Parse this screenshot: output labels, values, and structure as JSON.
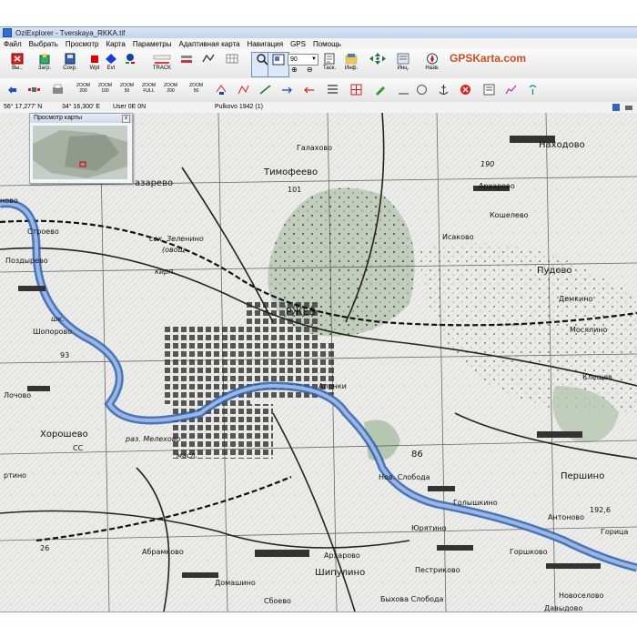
{
  "window": {
    "title": "OziExplorer - Tverskaya_RKKA.tif"
  },
  "menu": [
    "Файл",
    "Выбрать",
    "Просмотр",
    "Карта",
    "Параметры",
    "Адаптивная карта",
    "Навигация",
    "GPS",
    "Помощь"
  ],
  "toolbar": {
    "exit_label": "Вы..",
    "load_label": "Загр.",
    "save_label": "Сохр.",
    "wpt_label": "Wpt",
    "evt_label": "Evt",
    "track_label": "TRACK",
    "zoom_value": "90",
    "task_label": "Таск.",
    "info_label": "Инф.",
    "info2_label": "Инц.",
    "nav_label": "Назв.",
    "brand": "GPSKarta.com"
  },
  "toolbar2": {
    "zoom_buttons": [
      "ZOOM 200",
      "ZOOM 100",
      "ZOOM 50",
      "ZOOM FULL",
      "ZOOM 200",
      "ZOOM 50"
    ]
  },
  "status": {
    "lat": "56° 17,277' N",
    "lon": "34° 16,300' E",
    "user": "User 0E  0N",
    "datum": "Pulkovo 1942 (1)"
  },
  "overview": {
    "title": "Просмотр карты",
    "close": "x"
  },
  "map_labels": {
    "rzhev": "РЖЕВ",
    "timofeevo": "Тимофеево",
    "galahovo": "Галахово",
    "nahodovo": "Находово",
    "arharovo1": "Архарово",
    "koshelevo": "Кошелево",
    "isakovo": "Исаково",
    "pudovo": "Пудово",
    "demkino": "Демкино",
    "mosyalino": "Мосялино",
    "kleshevo": "Клещев",
    "lazarevo": "азарево",
    "lovo": "ново",
    "strojevo": "Строево",
    "pozdyrevo": "Поздырево",
    "zelenino": "сех. Зеленино",
    "ovosh": "(овощ",
    "kirp": "кирп.",
    "shoporovo": "Шопорово",
    "shk": "шк.",
    "aponki": "Апонки",
    "meleshovo": "раз. Мелехово",
    "masl": "масл.",
    "khoroshevo": "Хорошево",
    "otino": "ртино",
    "cc": "СС",
    "nov_sloboda": "Нов. Слобода",
    "golyshkino": "Голышкино",
    "pershino": "Першино",
    "antonovo": "Антоново",
    "goricy": "Горица",
    "yurtatino": "Юрятино",
    "goroshkovo": "Горшково",
    "arharovo2": "Архарово",
    "abramkovo": "Абрамково",
    "shipulino": "Шипулино",
    "pestrikovo": "Пестриково",
    "domashino": "Домашино",
    "novoselovo": "Новоселово",
    "sboevo": "Сбоево",
    "byhova_sloboda": "Быхова Слобода",
    "davydovo": "Давыдово",
    "lochovo": "Лочово",
    "num86": "86",
    "num1926": "192,6",
    "num190": "190",
    "num93": "93",
    "num26": "26",
    "num101": "101"
  }
}
